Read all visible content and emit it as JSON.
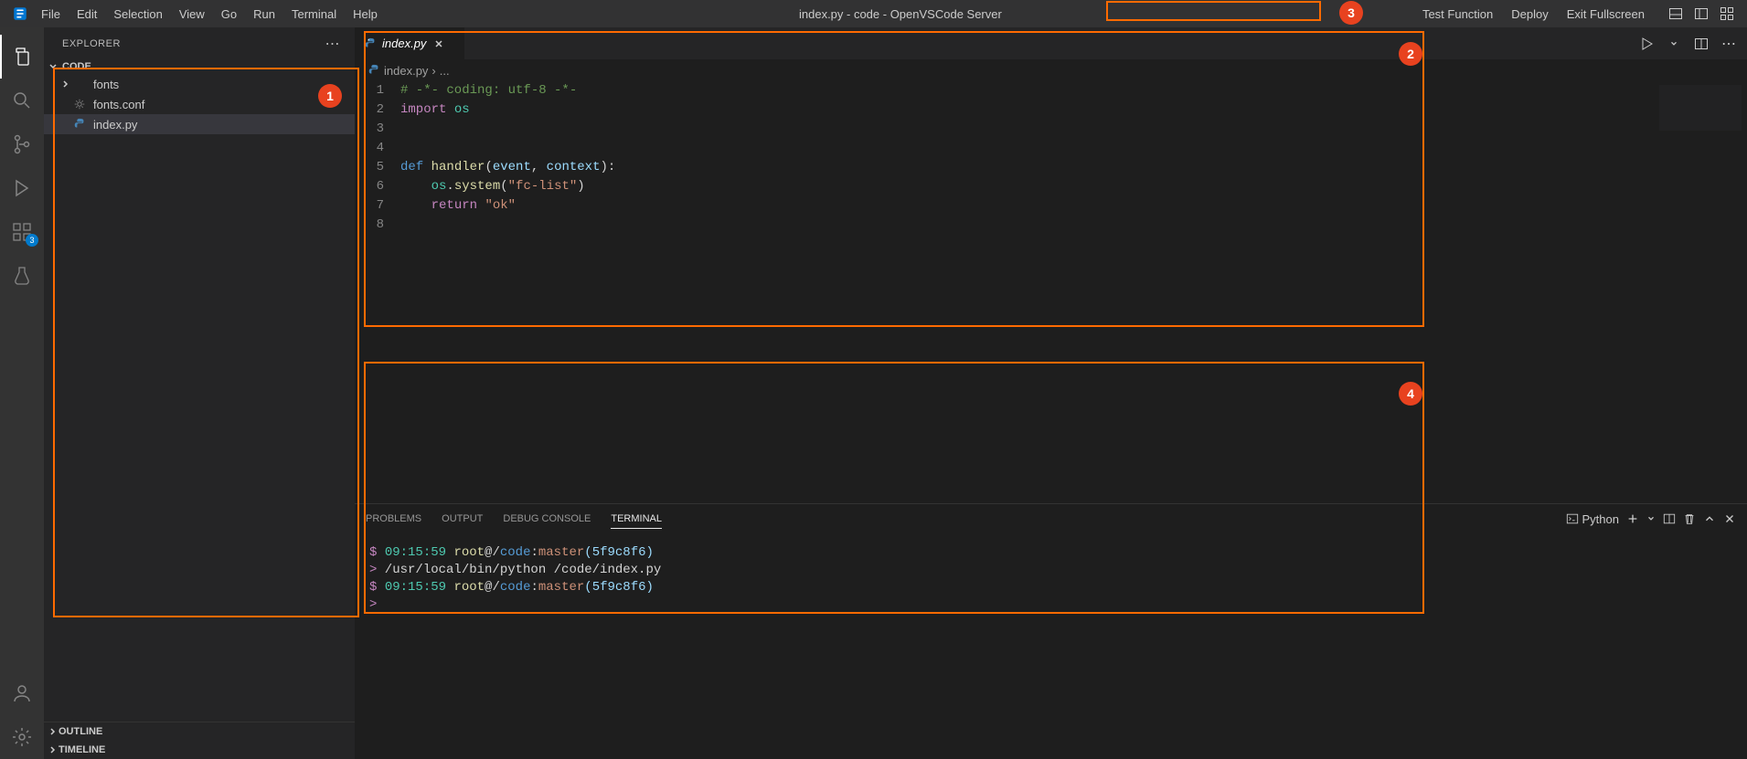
{
  "titlebar": {
    "menus": [
      "File",
      "Edit",
      "Selection",
      "View",
      "Go",
      "Run",
      "Terminal",
      "Help"
    ],
    "window_title": "index.py - code - OpenVSCode Server",
    "actions": [
      "Test Function",
      "Deploy",
      "Exit Fullscreen"
    ]
  },
  "activity_bar": {
    "extensions_badge": "3"
  },
  "sidebar": {
    "title": "EXPLORER",
    "root": "CODE",
    "items": [
      {
        "kind": "folder",
        "label": "fonts",
        "expanded": false
      },
      {
        "kind": "file",
        "label": "fonts.conf",
        "icon": "gear-icon"
      },
      {
        "kind": "file",
        "label": "index.py",
        "icon": "python-icon",
        "selected": true
      }
    ],
    "collapsed_sections": [
      "OUTLINE",
      "TIMELINE"
    ]
  },
  "editor": {
    "tab_label": "index.py",
    "breadcrumb": {
      "file": "index.py",
      "rest": "..."
    },
    "lines": [
      [
        {
          "t": "comment",
          "v": "# -*- coding: utf-8 -*-"
        }
      ],
      [
        {
          "t": "keyword",
          "v": "import"
        },
        {
          "t": "punc",
          "v": " "
        },
        {
          "t": "builtin",
          "v": "os"
        }
      ],
      [],
      [],
      [
        {
          "t": "def",
          "v": "def"
        },
        {
          "t": "punc",
          "v": " "
        },
        {
          "t": "func",
          "v": "handler"
        },
        {
          "t": "punc",
          "v": "("
        },
        {
          "t": "var",
          "v": "event"
        },
        {
          "t": "punc",
          "v": ", "
        },
        {
          "t": "var",
          "v": "context"
        },
        {
          "t": "punc",
          "v": "):"
        }
      ],
      [
        {
          "t": "punc",
          "v": "    "
        },
        {
          "t": "builtin",
          "v": "os"
        },
        {
          "t": "punc",
          "v": "."
        },
        {
          "t": "func",
          "v": "system"
        },
        {
          "t": "punc",
          "v": "("
        },
        {
          "t": "string",
          "v": "\"fc-list\""
        },
        {
          "t": "punc",
          "v": ")"
        }
      ],
      [
        {
          "t": "punc",
          "v": "    "
        },
        {
          "t": "keyword",
          "v": "return"
        },
        {
          "t": "punc",
          "v": " "
        },
        {
          "t": "string",
          "v": "\"ok\""
        }
      ],
      []
    ]
  },
  "panel": {
    "tabs": [
      "PROBLEMS",
      "OUTPUT",
      "DEBUG CONSOLE",
      "TERMINAL"
    ],
    "active_tab": "TERMINAL",
    "shell_label": "Python",
    "terminal_lines": [
      {
        "type": "prompt",
        "dollar": "$",
        "time": "09:15:59",
        "user": "root",
        "at": "@/",
        "path": "code",
        "sep": ":",
        "branch": "master",
        "hash": "(5f9c8f6)"
      },
      {
        "type": "cmd",
        "arrow": ">",
        "text": " /usr/local/bin/python /code/index.py"
      },
      {
        "type": "prompt",
        "dollar": "$",
        "time": "09:15:59",
        "user": "root",
        "at": "@/",
        "path": "code",
        "sep": ":",
        "branch": "master",
        "hash": "(5f9c8f6)"
      },
      {
        "type": "cmd",
        "arrow": ">",
        "text": ""
      }
    ]
  },
  "annotations": {
    "1": "1",
    "2": "2",
    "3": "3",
    "4": "4"
  }
}
